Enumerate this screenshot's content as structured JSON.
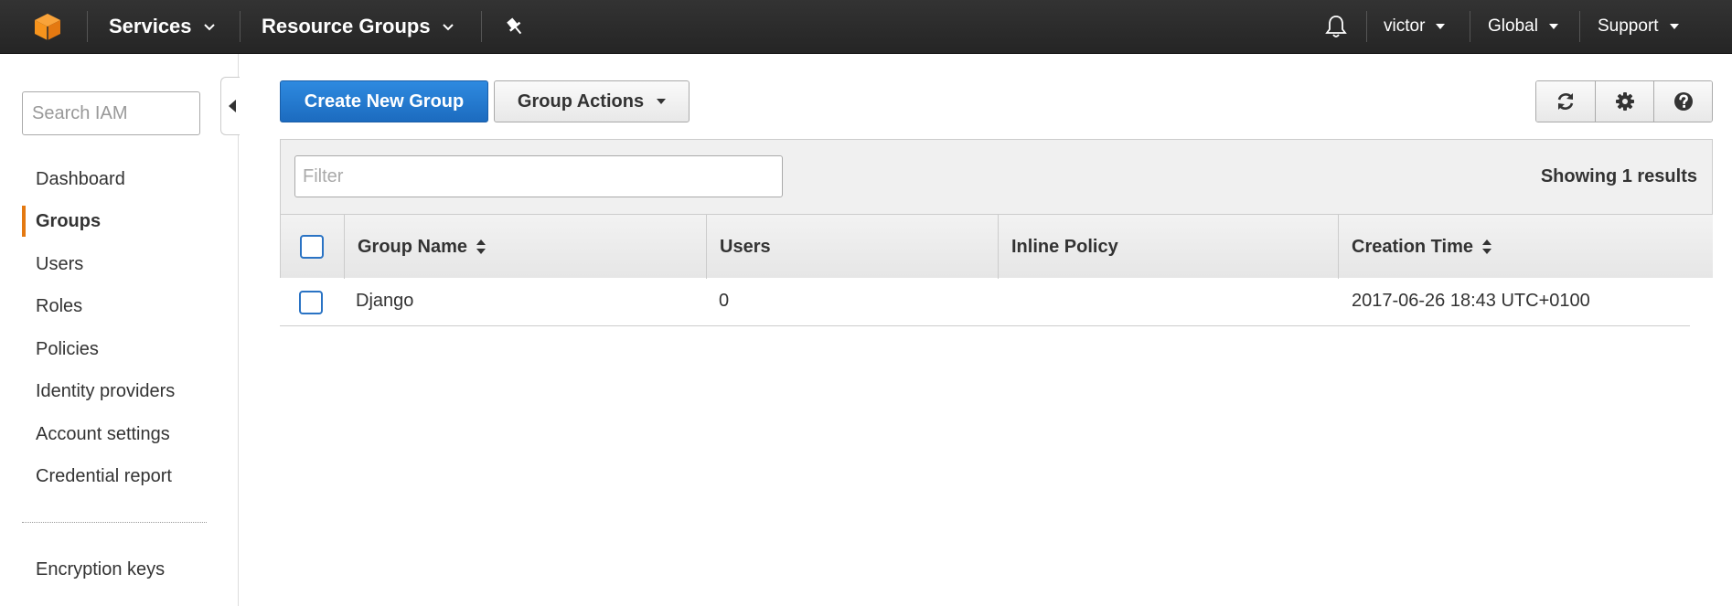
{
  "topbar": {
    "services_label": "Services",
    "resource_groups_label": "Resource Groups",
    "user_label": "victor",
    "region_label": "Global",
    "support_label": "Support"
  },
  "sidebar": {
    "search_placeholder": "Search IAM",
    "items": [
      {
        "label": "Dashboard"
      },
      {
        "label": "Groups",
        "active": true
      },
      {
        "label": "Users"
      },
      {
        "label": "Roles"
      },
      {
        "label": "Policies"
      },
      {
        "label": "Identity providers"
      },
      {
        "label": "Account settings"
      },
      {
        "label": "Credential report"
      }
    ],
    "secondary_items": [
      {
        "label": "Encryption keys"
      }
    ]
  },
  "toolbar": {
    "create_label": "Create New Group",
    "actions_label": "Group Actions"
  },
  "filter": {
    "placeholder": "Filter",
    "results_text": "Showing 1 results"
  },
  "table": {
    "columns": [
      "Group Name",
      "Users",
      "Inline Policy",
      "Creation Time"
    ],
    "rows": [
      {
        "name": "Django",
        "users": "0",
        "inline_policy": "",
        "creation_time": "2017-06-26 18:43 UTC+0100"
      }
    ]
  },
  "colors": {
    "topbar": "#2b2b2b",
    "primary_button": "#1c6bbf",
    "active_indicator": "#e47911",
    "logo": "#f90"
  },
  "icons": [
    "aws-logo",
    "chevron-down-icon",
    "pin-icon",
    "bell-icon",
    "refresh-icon",
    "gear-icon",
    "help-icon",
    "sort-icon",
    "collapse-icon"
  ]
}
